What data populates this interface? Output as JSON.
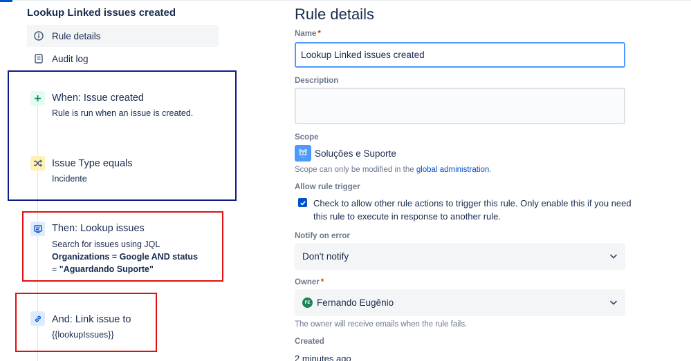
{
  "sidebar": {
    "rule_title": "Lookup Linked issues created",
    "nav": [
      {
        "label": "Rule details",
        "icon": "info-icon",
        "active": true
      },
      {
        "label": "Audit log",
        "icon": "audit-log-icon",
        "active": false
      }
    ],
    "components": [
      {
        "title": "When: Issue created",
        "subtitle": "Rule is run when an issue is created.",
        "icon": "plus-icon",
        "icon_bg": "#e3fcef",
        "icon_fg": "#00875a"
      },
      {
        "title": "Issue Type equals",
        "subtitle": "Incidente",
        "icon": "shuffle-icon",
        "icon_bg": "#fff0b3",
        "icon_fg": "#5e4db2"
      },
      {
        "title": "Then: Lookup issues",
        "subtitle": "Search for issues using JQL",
        "jql_line1": "Organizations = Google AND status",
        "jql_line2_prefix": "= ",
        "jql_line2_bold": "\"Aguardando Suporte\"",
        "icon": "monitor-icon",
        "icon_bg": "#deebff",
        "icon_fg": "#0052cc"
      },
      {
        "title": "And: Link issue to",
        "subtitle": "{{lookupIssues}}",
        "icon": "link-icon",
        "icon_bg": "#deebff",
        "icon_fg": "#0052cc"
      }
    ]
  },
  "main": {
    "heading": "Rule details",
    "name_label": "Name",
    "required_mark": "*",
    "name_value": "Lookup Linked issues created",
    "description_label": "Description",
    "description_value": "",
    "scope_label": "Scope",
    "scope_value": "Soluções e Suporte",
    "scope_help_prefix": "Scope can only be modified in the ",
    "scope_help_link": "global administration",
    "scope_help_suffix": ".",
    "allow_trigger_label": "Allow rule trigger",
    "allow_trigger_text": "Check to allow other rule actions to trigger this rule. Only enable this if you need this rule to execute in response to another rule.",
    "allow_trigger_checked": true,
    "notify_label": "Notify on error",
    "notify_value": "Don't notify",
    "owner_label": "Owner",
    "owner_initials": "FE",
    "owner_value": "Fernando Eugênio",
    "owner_help": "The owner will receive emails when the rule fails.",
    "created_label": "Created",
    "created_value": "2 minutes ago"
  },
  "colors": {
    "accent": "#0052cc",
    "focus_border": "#4c9aff",
    "annotation_blue": "#0b1a8c",
    "annotation_red": "#e01010",
    "owner_avatar": "#1f845a"
  }
}
